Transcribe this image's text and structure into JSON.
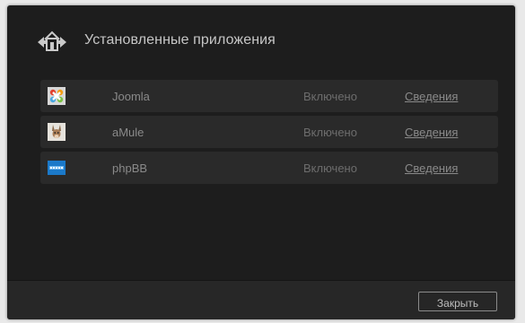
{
  "dialog": {
    "title": "Установленные приложения"
  },
  "apps": [
    {
      "name": "Joomla",
      "status": "Включено",
      "details_label": "Сведения",
      "icon": "joomla-logo-icon"
    },
    {
      "name": "aMule",
      "status": "Включено",
      "details_label": "Сведения",
      "icon": "amule-logo-icon"
    },
    {
      "name": "phpBB",
      "status": "Включено",
      "details_label": "Сведения",
      "icon": "phpbb-logo-icon"
    }
  ],
  "footer": {
    "close_label": "Закрыть"
  },
  "colors": {
    "background": "#1d1d1d",
    "row_background": "#2a2a2a",
    "text": "#8a8a8a",
    "title": "#c6c6c6"
  }
}
